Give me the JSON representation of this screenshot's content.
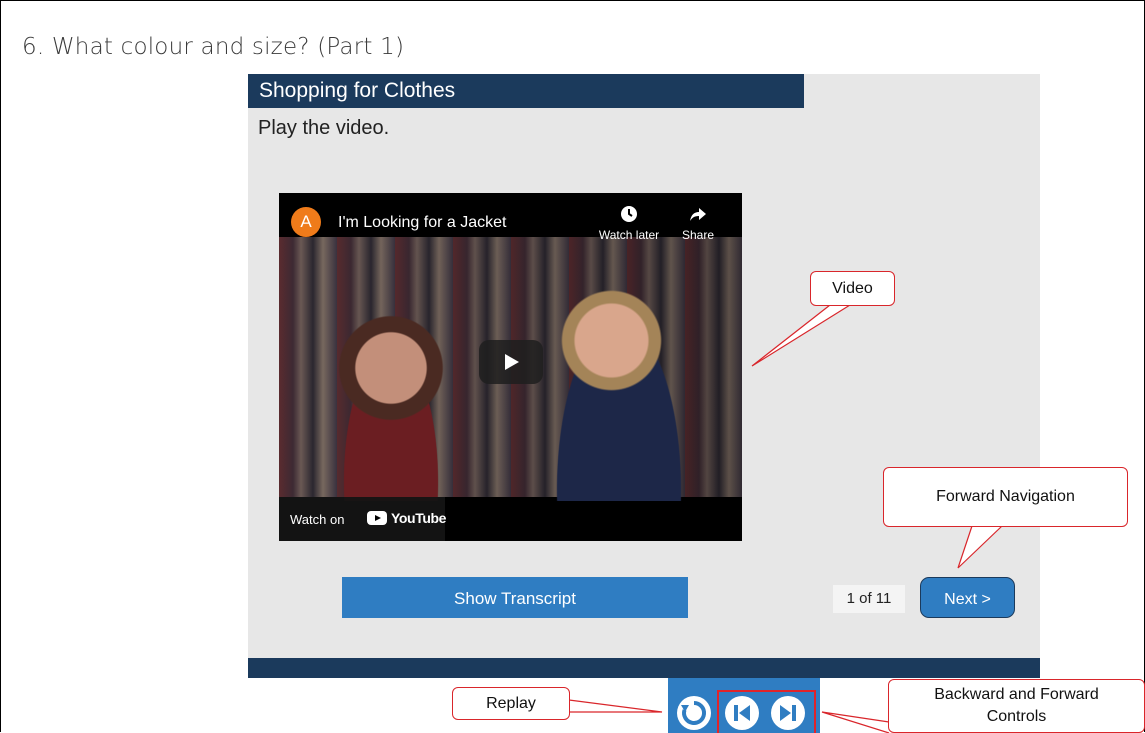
{
  "page": {
    "title": "6. What colour and size? (Part 1)"
  },
  "lesson": {
    "header": "Shopping for Clothes",
    "instruction": "Play the video."
  },
  "video": {
    "channel_initial": "A",
    "title": "I'm Looking for a Jacket",
    "watch_later_label": "Watch later",
    "watch_later_icon": "clock-icon",
    "share_label": "Share",
    "share_icon": "share-arrow-icon",
    "play_icon": "play-icon",
    "watch_on_label": "Watch on",
    "platform_logo": "YouTube"
  },
  "controls": {
    "show_transcript": "Show Transcript",
    "page_count": "1 of 11",
    "next": "Next >",
    "replay_icon": "replay-icon",
    "back_icon": "skip-back-icon",
    "forward_icon": "skip-forward-icon"
  },
  "callouts": {
    "video": "Video",
    "forward_navigation": "Forward Navigation",
    "replay": "Replay",
    "backward_forward_line1": "Backward and Forward",
    "backward_forward_line2": "Controls"
  },
  "colors": {
    "header_navy": "#1b3a5c",
    "button_blue": "#2f7dc2",
    "callout_red": "#e0242a",
    "panel_gray": "#e7e7e7",
    "avatar_orange": "#ef7b1a"
  }
}
